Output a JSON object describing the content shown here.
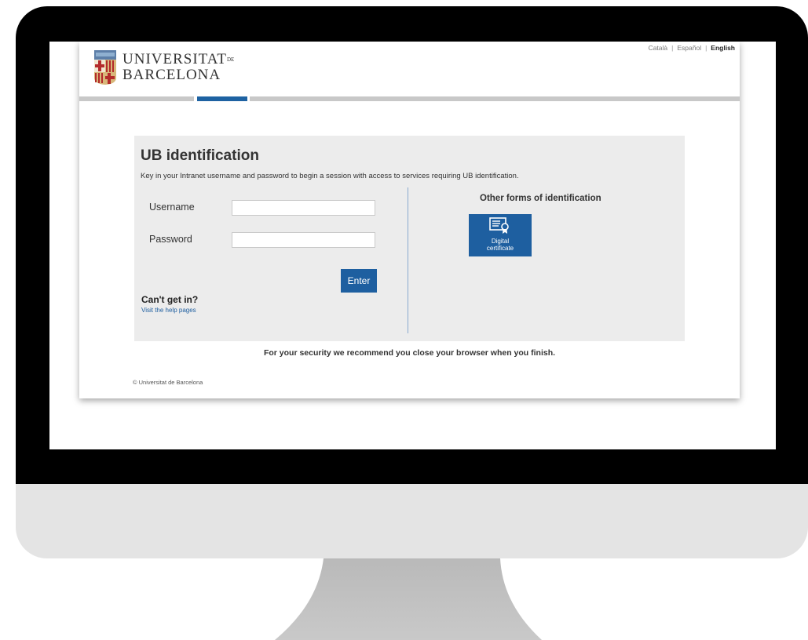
{
  "languages": {
    "catalan": "Català",
    "spanish": "Español",
    "english": "English",
    "separator": "|",
    "active": "English"
  },
  "logo": {
    "line1_main": "UNIVERSITAT",
    "line1_small": "DE",
    "line2": "BARCELONA"
  },
  "login": {
    "title": "UB identification",
    "intro": "Key in your Intranet username and password to begin a session with access to services requiring UB identification.",
    "username_label": "Username",
    "username_value": "",
    "password_label": "Password",
    "password_value": "",
    "enter_label": "Enter",
    "cant_get_in": "Can't get in?",
    "help_link": "Visit the help pages"
  },
  "other_forms": {
    "title": "Other forms of identification",
    "certificate_line1": "Digital",
    "certificate_line2": "certificate",
    "certificate_icon": "certificate-icon"
  },
  "security_note": "For your security we recommend you close your browser when you finish.",
  "copyright": "© Universitat de Barcelona",
  "colors": {
    "brand_blue": "#1e5fa0",
    "panel_gray": "#ececec",
    "monitor_black": "#000000",
    "monitor_chin": "#e4e4e4"
  }
}
